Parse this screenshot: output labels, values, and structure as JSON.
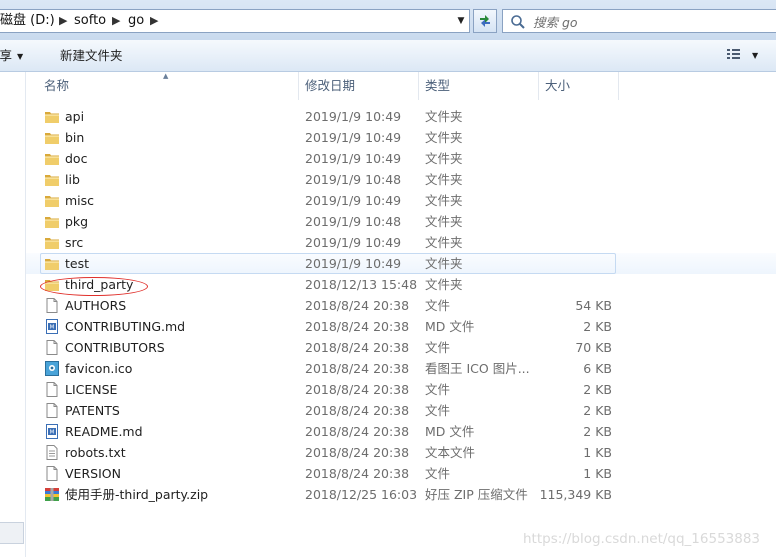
{
  "address_bar": {
    "crumbs": [
      "磁盘 (D:)",
      "softo",
      "go"
    ],
    "separator": "▶",
    "dropdown": "▼"
  },
  "search": {
    "placeholder": "搜索 go"
  },
  "toolbar": {
    "share_label": "共享",
    "new_folder_label": "新建文件夹"
  },
  "columns": {
    "name": "名称",
    "date": "修改日期",
    "type": "类型",
    "size": "大小"
  },
  "files": [
    {
      "name": "api",
      "date": "2019/1/9 10:49",
      "type": "文件夹",
      "size": "",
      "icon": "folder-icon",
      "selected": false
    },
    {
      "name": "bin",
      "date": "2019/1/9 10:49",
      "type": "文件夹",
      "size": "",
      "icon": "folder-icon",
      "selected": false
    },
    {
      "name": "doc",
      "date": "2019/1/9 10:49",
      "type": "文件夹",
      "size": "",
      "icon": "folder-icon",
      "selected": false
    },
    {
      "name": "lib",
      "date": "2019/1/9 10:48",
      "type": "文件夹",
      "size": "",
      "icon": "folder-icon",
      "selected": false
    },
    {
      "name": "misc",
      "date": "2019/1/9 10:49",
      "type": "文件夹",
      "size": "",
      "icon": "folder-icon",
      "selected": false
    },
    {
      "name": "pkg",
      "date": "2019/1/9 10:48",
      "type": "文件夹",
      "size": "",
      "icon": "folder-icon",
      "selected": false
    },
    {
      "name": "src",
      "date": "2019/1/9 10:49",
      "type": "文件夹",
      "size": "",
      "icon": "folder-icon",
      "selected": false
    },
    {
      "name": "test",
      "date": "2019/1/9 10:49",
      "type": "文件夹",
      "size": "",
      "icon": "folder-icon",
      "selected": true
    },
    {
      "name": "third_party",
      "date": "2018/12/13 15:48",
      "type": "文件夹",
      "size": "",
      "icon": "folder-icon",
      "selected": false
    },
    {
      "name": "AUTHORS",
      "date": "2018/8/24 20:38",
      "type": "文件",
      "size": "54 KB",
      "icon": "file-icon",
      "selected": false
    },
    {
      "name": "CONTRIBUTING.md",
      "date": "2018/8/24 20:38",
      "type": "MD 文件",
      "size": "2 KB",
      "icon": "md-file-icon",
      "selected": false
    },
    {
      "name": "CONTRIBUTORS",
      "date": "2018/8/24 20:38",
      "type": "文件",
      "size": "70 KB",
      "icon": "file-icon",
      "selected": false
    },
    {
      "name": "favicon.ico",
      "date": "2018/8/24 20:38",
      "type": "看图王 ICO 图片...",
      "size": "6 KB",
      "icon": "ico-file-icon",
      "selected": false
    },
    {
      "name": "LICENSE",
      "date": "2018/8/24 20:38",
      "type": "文件",
      "size": "2 KB",
      "icon": "file-icon",
      "selected": false
    },
    {
      "name": "PATENTS",
      "date": "2018/8/24 20:38",
      "type": "文件",
      "size": "2 KB",
      "icon": "file-icon",
      "selected": false
    },
    {
      "name": "README.md",
      "date": "2018/8/24 20:38",
      "type": "MD 文件",
      "size": "2 KB",
      "icon": "md-file-icon",
      "selected": false
    },
    {
      "name": "robots.txt",
      "date": "2018/8/24 20:38",
      "type": "文本文件",
      "size": "1 KB",
      "icon": "text-file-icon",
      "selected": false
    },
    {
      "name": "VERSION",
      "date": "2018/8/24 20:38",
      "type": "文件",
      "size": "1 KB",
      "icon": "file-icon",
      "selected": false
    },
    {
      "name": "使用手册-third_party.zip",
      "date": "2018/12/25 16:03",
      "type": "好压 ZIP 压缩文件",
      "size": "115,349 KB",
      "icon": "zip-file-icon",
      "selected": false
    }
  ],
  "watermark": "https://blog.csdn.net/qq_16553883",
  "colors": {
    "folder": "#e8c25a",
    "selection_border": "#c5daf2",
    "annotation": "#e0302b"
  }
}
